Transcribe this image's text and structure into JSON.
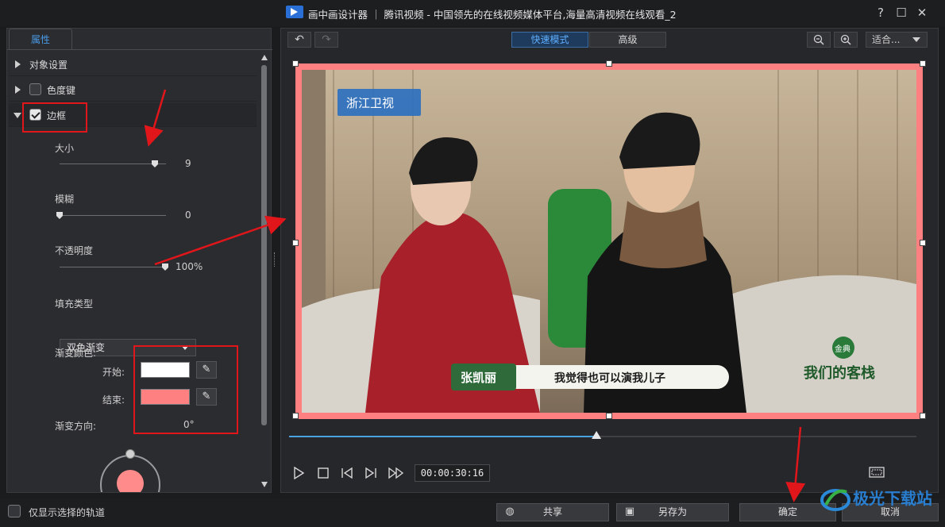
{
  "window": {
    "title": "画中画设计器 ｜ 腾讯视频 - 中国领先的在线视频媒体平台,海量高清视频在线观看_2",
    "help": "?",
    "maximize": "☐",
    "close": "✕"
  },
  "left": {
    "tab": "属性",
    "sections": {
      "object_settings": "对象设置",
      "chroma_key": "色度键",
      "border": "边框"
    },
    "size": {
      "label": "大小",
      "value": "9",
      "level": 0.9
    },
    "blur": {
      "label": "模糊",
      "value": "0",
      "level": 0
    },
    "opacity": {
      "label": "不透明度",
      "value": "100%",
      "level": 1.0
    },
    "fill_type": {
      "label": "填充类型",
      "value": "双色渐变"
    },
    "gradient": {
      "label": "渐变颜色:",
      "start_label": "开始:",
      "end_label": "结束:",
      "start_color": "#ffffff",
      "end_color": "#ff8080",
      "direction_label": "渐变方向:",
      "direction_value": "0°"
    }
  },
  "toolbar": {
    "undo": "↶",
    "redo": "↷",
    "quick_mode": "快速模式",
    "advanced": "高级",
    "zoom_out": "−",
    "zoom_in": "+",
    "fit": "适合..."
  },
  "preview": {
    "channel_logo": "浙江卫视",
    "subtitle_name": "张凯丽",
    "subtitle_text": "我觉得也可以演我儿子",
    "show_logo": "我们的客栈",
    "brand_badge": "金典"
  },
  "player": {
    "timecode": "00:00:30:16",
    "progress": 0.49
  },
  "bottom": {
    "show_selected_tracks": "仅显示选择的轨道",
    "share": "共享",
    "save_as": "另存为",
    "ok": "确定",
    "cancel": "取消"
  },
  "watermark": "极光下载站",
  "colors": {
    "accent": "#4a9be8",
    "annotation_red": "#e0161b",
    "border_pink": "#ff8080"
  }
}
